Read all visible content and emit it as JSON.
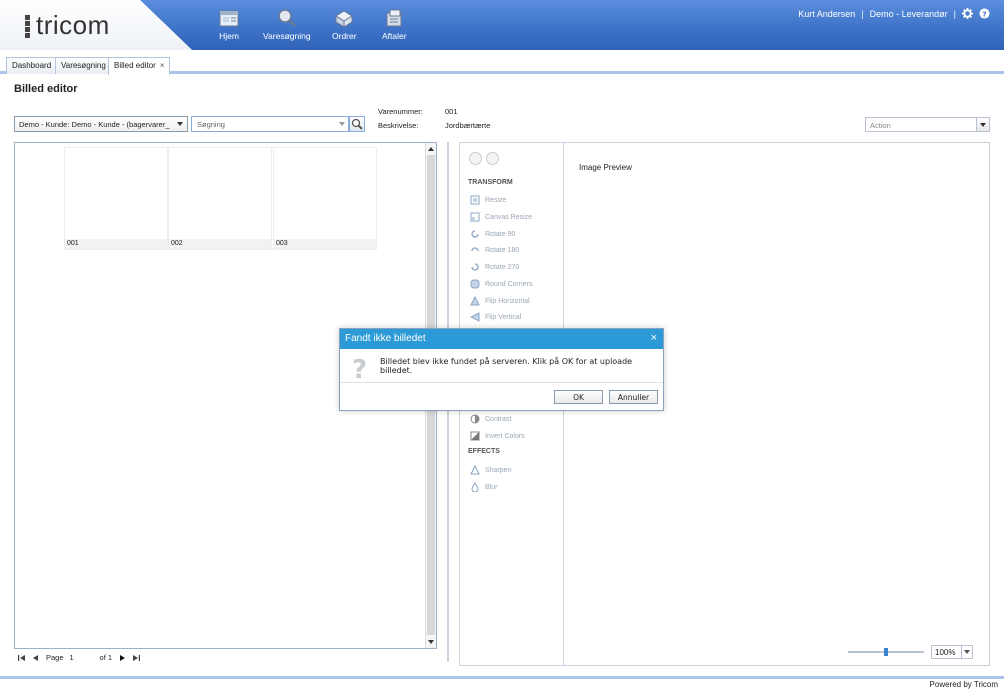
{
  "header": {
    "logo_text": "tricom",
    "nav": [
      {
        "label": "Hjem",
        "icon": "home-icon"
      },
      {
        "label": "Varesøgning",
        "icon": "magnifier-icon"
      },
      {
        "label": "Ordrer",
        "icon": "orders-icon"
      },
      {
        "label": "Aftaler",
        "icon": "agreements-icon"
      }
    ],
    "user_name": "Kurt Andersen",
    "company": "Demo - Leverandør",
    "separator": "|"
  },
  "tabs": [
    {
      "label": "Dashboard"
    },
    {
      "label": "Varesøgning"
    },
    {
      "label": "Billed editor",
      "close": "×"
    }
  ],
  "page": {
    "title": "Billed editor",
    "customer_select": "Demo - Kunde: Demo - Kunde - (bagervarer_",
    "search_placeholder": "Søgning",
    "varenummer_label": "Varenummer:",
    "varenummer_value": "001",
    "beskrivelse_label": "Beskrivelse:",
    "beskrivelse_value": "Jordbærtærte",
    "action_placeholder": "Action"
  },
  "images": [
    {
      "caption": "001"
    },
    {
      "caption": "002"
    },
    {
      "caption": "003"
    }
  ],
  "pager": {
    "page_label": "Page",
    "page_value": "1",
    "of_label": "of 1"
  },
  "editor": {
    "preview_title": "Image Preview",
    "transform_heading": "TRANSFORM",
    "transform_tools": [
      "Resize",
      "Canvas Resize",
      "Rotate 90",
      "Rotate 180",
      "Rotate 270",
      "Round Corners",
      "Flip Horizontal",
      "Flip Vertical"
    ],
    "adjust_tools": [
      "Contrast",
      "Invert Colors"
    ],
    "effects_heading": "EFFECTS",
    "effects_tools": [
      "Sharpen",
      "Blur"
    ],
    "zoom_value": "100%",
    "zoom_level": 0.5
  },
  "dialog": {
    "title": "Fandt ikke billedet",
    "close": "×",
    "message": "Billedet blev ikke fundet på serveren. Klik på OK for at uploade billedet.",
    "ok_label": "OK",
    "cancel_label": "Annuller",
    "icon": "question-icon",
    "header_color": "#2c9ad6"
  },
  "footer": {
    "powered_by": "Powered by Tricom"
  }
}
